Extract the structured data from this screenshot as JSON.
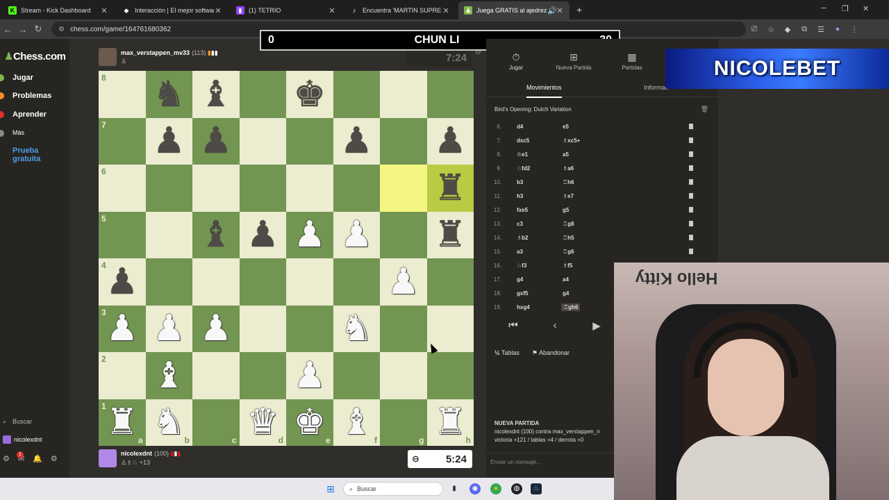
{
  "browser": {
    "tabs": [
      {
        "label": "Stream - Kick Dashboard",
        "icon": "kick-icon",
        "active": false
      },
      {
        "label": "Interacción | El mejor software",
        "icon": "streamelements-icon",
        "active": false
      },
      {
        "label": "(1) TETRIO",
        "icon": "twitch-icon",
        "active": false
      },
      {
        "label": "Encuentra 'MARTIN SUPREME'",
        "icon": "tiktok-icon",
        "active": false
      },
      {
        "label": "Juega GRATIS al ajedrez en",
        "icon": "chess-icon",
        "active": true
      }
    ],
    "url": "chess.com/game/164761680362"
  },
  "sidebar": {
    "logo": "Chess.com",
    "items": [
      {
        "label": "Jugar",
        "color": "#81b64c"
      },
      {
        "label": "Problemas",
        "color": "#f58b24"
      },
      {
        "label": "Aprender",
        "color": "#e0312b"
      },
      {
        "label": "Más",
        "color": "#888888"
      },
      {
        "label": "Prueba gratuita",
        "color": "#4f9ee8"
      }
    ],
    "search": "Buscar",
    "user": "nicolexdnt",
    "notif_count": "1"
  },
  "score": {
    "left": "0",
    "name": "CHUN LI",
    "right": "30"
  },
  "top_player": {
    "name": "max_verstappen_mv33",
    "rating": "(113)",
    "clock": "7:24"
  },
  "bottom_player": {
    "name": "nicolexdnt",
    "rating": "(100)",
    "material": "+13",
    "clock": "5:24"
  },
  "board": {
    "files": [
      "a",
      "b",
      "c",
      "d",
      "e",
      "f",
      "g",
      "h"
    ],
    "ranks": [
      "8",
      "7",
      "6",
      "5",
      "4",
      "3",
      "2",
      "1"
    ],
    "pieces": [
      [
        "",
        "bn",
        "bb",
        "",
        "bk",
        "",
        "",
        ""
      ],
      [
        "",
        "bp",
        "bp",
        "",
        "",
        "bp",
        "",
        "bp"
      ],
      [
        "",
        "",
        "",
        "",
        "",
        "",
        "",
        "br"
      ],
      [
        "",
        "",
        "bb",
        "bp",
        "wp",
        "wp",
        "",
        "br"
      ],
      [
        "bp",
        "",
        "",
        "",
        "",
        "",
        "wp",
        ""
      ],
      [
        "wp",
        "wp",
        "wp",
        "",
        "",
        "wn",
        "",
        ""
      ],
      [
        "",
        "wb",
        "",
        "",
        "wp",
        "",
        "",
        ""
      ],
      [
        "wr",
        "wn",
        "",
        "wq",
        "wk",
        "wb",
        "",
        "wr"
      ]
    ],
    "highlights": [
      "g6",
      "h6"
    ]
  },
  "panel": {
    "tabs": [
      {
        "label": "Jugar",
        "icon": "stopwatch-icon"
      },
      {
        "label": "Nueva Partida",
        "icon": "plus-icon"
      },
      {
        "label": "Partidas",
        "icon": "board-icon"
      }
    ],
    "subtabs": [
      "Movimientos",
      "Informac"
    ],
    "opening": "Bird's Opening: Dutch Variation",
    "moves": [
      {
        "no": "6.",
        "w": "d4",
        "b": "e5"
      },
      {
        "no": "7.",
        "w": "dxc5",
        "b": "♗xc5+"
      },
      {
        "no": "8.",
        "w": "♔e1",
        "b": "a5"
      },
      {
        "no": "9.",
        "w": "♘fd2",
        "b": "♗a6"
      },
      {
        "no": "10.",
        "w": "b3",
        "b": "♖h6"
      },
      {
        "no": "11.",
        "w": "h3",
        "b": "♗e7"
      },
      {
        "no": "12.",
        "w": "fxe5",
        "b": "g5"
      },
      {
        "no": "13.",
        "w": "c3",
        "b": "♖g8"
      },
      {
        "no": "14.",
        "w": "♗b2",
        "b": "♖h5"
      },
      {
        "no": "15.",
        "w": "a3",
        "b": "♖g6"
      },
      {
        "no": "16.",
        "w": "♘f3",
        "b": "♗f5"
      },
      {
        "no": "17.",
        "w": "g4",
        "b": "a4"
      },
      {
        "no": "18.",
        "w": "gxf5",
        "b": "g4"
      },
      {
        "no": "19.",
        "w": "hxg4",
        "b": "♖gh6"
      }
    ],
    "draw": "Tablas",
    "resign": "Abandonar",
    "new_game_title": "NUEVA PARTIDA",
    "new_game_line1": "nicolexdnt (100) contra max_verstappen_n",
    "new_game_line2": "victoria +121 / tablas +4 / derrota +0",
    "message_placeholder": "Enviar un mensaje..."
  },
  "overlay": {
    "sponsor": "NICOLEBET",
    "webcam_text": "Hello Kitty"
  },
  "taskbar": {
    "search": "Buscar"
  }
}
